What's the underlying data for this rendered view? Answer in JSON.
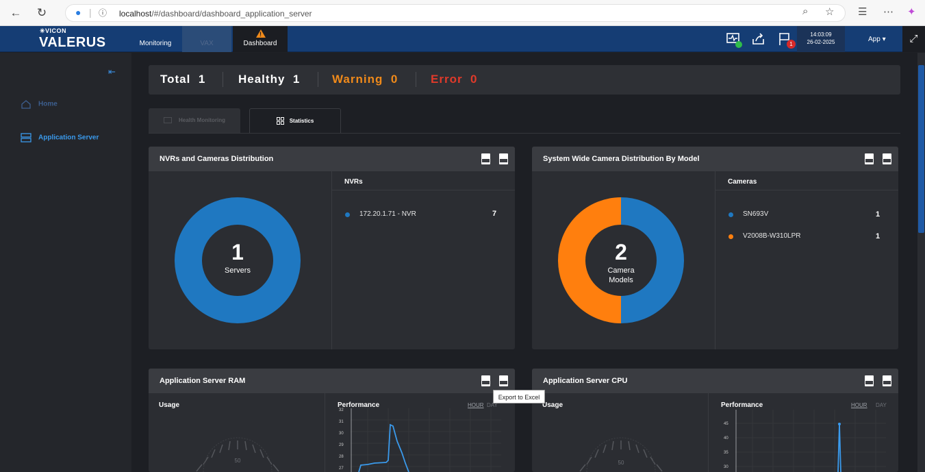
{
  "browser": {
    "url_host": "localhost",
    "url_path": "/#/dashboard/dashboard_application_server"
  },
  "app": {
    "logo_small": "VICON",
    "logo_big": "VALERUS",
    "tabs": [
      {
        "label": "Monitoring"
      },
      {
        "label": "VAX"
      },
      {
        "label": "Dashboard"
      }
    ],
    "notification_count": "1",
    "time": "14:03:09",
    "date": "26-02-2025",
    "app_menu": "App"
  },
  "sidebar": {
    "items": [
      {
        "label": "Home",
        "icon": "home-icon"
      },
      {
        "label": "Application Server",
        "icon": "server-icon"
      }
    ]
  },
  "summary": {
    "total_label": "Total",
    "total_value": "1",
    "healthy_label": "Healthy",
    "healthy_value": "1",
    "warning_label": "Warning",
    "warning_value": "0",
    "error_label": "Error",
    "error_value": "0"
  },
  "subtabs": [
    {
      "label": "Health Monitoring"
    },
    {
      "label": "Statistics"
    }
  ],
  "panels": {
    "nvr": {
      "title": "NVRs and Cameras Distribution",
      "center_number": "1",
      "center_label": "Servers",
      "list_header": "NVRs",
      "items": [
        {
          "label": "172.20.1.71 - NVR",
          "value": "7",
          "color": "#1f78c1"
        }
      ]
    },
    "camera_model": {
      "title": "System Wide Camera Distribution By Model",
      "center_number": "2",
      "center_label_1": "Camera",
      "center_label_2": "Models",
      "list_header": "Cameras",
      "items": [
        {
          "label": "SN693V",
          "value": "1",
          "color": "#1f78c1"
        },
        {
          "label": "V2008B-W310LPR",
          "value": "1",
          "color": "#ff7f0e"
        }
      ]
    },
    "ram": {
      "title": "Application Server RAM",
      "usage_label": "Usage",
      "gauge_value": "50",
      "performance_label": "Performance",
      "hour_label": "HOUR",
      "day_label": "DAY",
      "y_ticks": [
        "32",
        "31",
        "30",
        "29",
        "28",
        "27"
      ]
    },
    "cpu": {
      "title": "Application Server CPU",
      "usage_label": "Usage",
      "gauge_value": "50",
      "performance_label": "Performance",
      "hour_label": "HOUR",
      "day_label": "DAY",
      "y_ticks": [
        "45",
        "40",
        "35",
        "30"
      ]
    }
  },
  "tooltip": "Export to Excel",
  "colors": {
    "accent_blue": "#1f78c1",
    "accent_orange": "#ff7f0e",
    "warning": "#f08a1a",
    "error": "#e03a2a",
    "header_blue": "#153d74"
  }
}
